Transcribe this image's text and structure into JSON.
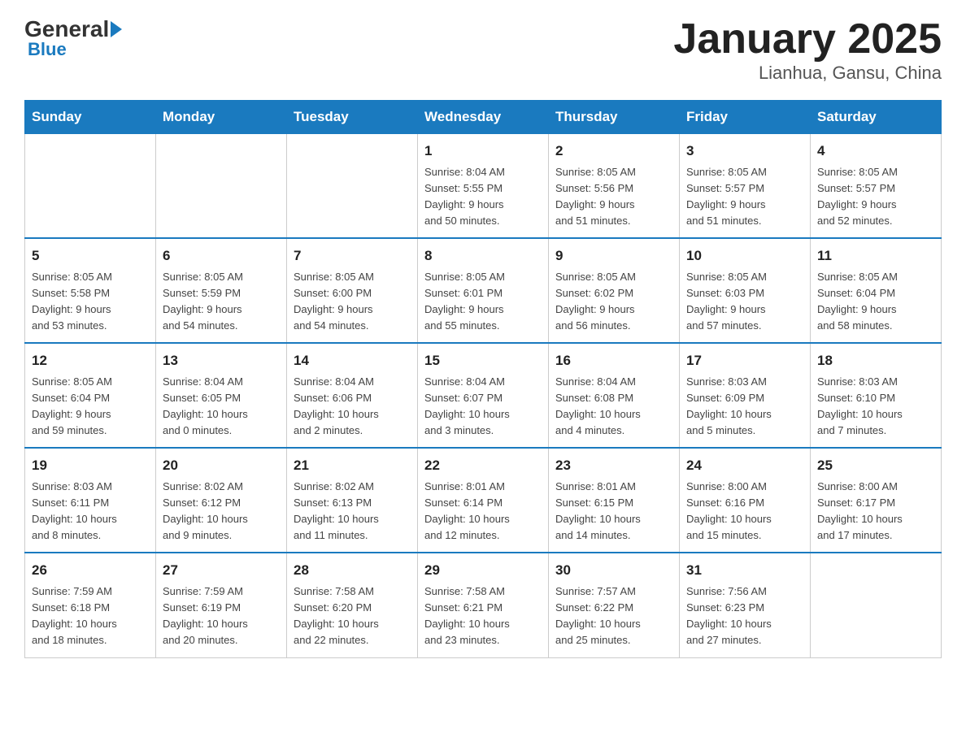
{
  "logo": {
    "general": "General",
    "blue": "Blue"
  },
  "title": "January 2025",
  "subtitle": "Lianhua, Gansu, China",
  "weekdays": [
    "Sunday",
    "Monday",
    "Tuesday",
    "Wednesday",
    "Thursday",
    "Friday",
    "Saturday"
  ],
  "weeks": [
    [
      {
        "day": "",
        "info": ""
      },
      {
        "day": "",
        "info": ""
      },
      {
        "day": "",
        "info": ""
      },
      {
        "day": "1",
        "info": "Sunrise: 8:04 AM\nSunset: 5:55 PM\nDaylight: 9 hours\nand 50 minutes."
      },
      {
        "day": "2",
        "info": "Sunrise: 8:05 AM\nSunset: 5:56 PM\nDaylight: 9 hours\nand 51 minutes."
      },
      {
        "day": "3",
        "info": "Sunrise: 8:05 AM\nSunset: 5:57 PM\nDaylight: 9 hours\nand 51 minutes."
      },
      {
        "day": "4",
        "info": "Sunrise: 8:05 AM\nSunset: 5:57 PM\nDaylight: 9 hours\nand 52 minutes."
      }
    ],
    [
      {
        "day": "5",
        "info": "Sunrise: 8:05 AM\nSunset: 5:58 PM\nDaylight: 9 hours\nand 53 minutes."
      },
      {
        "day": "6",
        "info": "Sunrise: 8:05 AM\nSunset: 5:59 PM\nDaylight: 9 hours\nand 54 minutes."
      },
      {
        "day": "7",
        "info": "Sunrise: 8:05 AM\nSunset: 6:00 PM\nDaylight: 9 hours\nand 54 minutes."
      },
      {
        "day": "8",
        "info": "Sunrise: 8:05 AM\nSunset: 6:01 PM\nDaylight: 9 hours\nand 55 minutes."
      },
      {
        "day": "9",
        "info": "Sunrise: 8:05 AM\nSunset: 6:02 PM\nDaylight: 9 hours\nand 56 minutes."
      },
      {
        "day": "10",
        "info": "Sunrise: 8:05 AM\nSunset: 6:03 PM\nDaylight: 9 hours\nand 57 minutes."
      },
      {
        "day": "11",
        "info": "Sunrise: 8:05 AM\nSunset: 6:04 PM\nDaylight: 9 hours\nand 58 minutes."
      }
    ],
    [
      {
        "day": "12",
        "info": "Sunrise: 8:05 AM\nSunset: 6:04 PM\nDaylight: 9 hours\nand 59 minutes."
      },
      {
        "day": "13",
        "info": "Sunrise: 8:04 AM\nSunset: 6:05 PM\nDaylight: 10 hours\nand 0 minutes."
      },
      {
        "day": "14",
        "info": "Sunrise: 8:04 AM\nSunset: 6:06 PM\nDaylight: 10 hours\nand 2 minutes."
      },
      {
        "day": "15",
        "info": "Sunrise: 8:04 AM\nSunset: 6:07 PM\nDaylight: 10 hours\nand 3 minutes."
      },
      {
        "day": "16",
        "info": "Sunrise: 8:04 AM\nSunset: 6:08 PM\nDaylight: 10 hours\nand 4 minutes."
      },
      {
        "day": "17",
        "info": "Sunrise: 8:03 AM\nSunset: 6:09 PM\nDaylight: 10 hours\nand 5 minutes."
      },
      {
        "day": "18",
        "info": "Sunrise: 8:03 AM\nSunset: 6:10 PM\nDaylight: 10 hours\nand 7 minutes."
      }
    ],
    [
      {
        "day": "19",
        "info": "Sunrise: 8:03 AM\nSunset: 6:11 PM\nDaylight: 10 hours\nand 8 minutes."
      },
      {
        "day": "20",
        "info": "Sunrise: 8:02 AM\nSunset: 6:12 PM\nDaylight: 10 hours\nand 9 minutes."
      },
      {
        "day": "21",
        "info": "Sunrise: 8:02 AM\nSunset: 6:13 PM\nDaylight: 10 hours\nand 11 minutes."
      },
      {
        "day": "22",
        "info": "Sunrise: 8:01 AM\nSunset: 6:14 PM\nDaylight: 10 hours\nand 12 minutes."
      },
      {
        "day": "23",
        "info": "Sunrise: 8:01 AM\nSunset: 6:15 PM\nDaylight: 10 hours\nand 14 minutes."
      },
      {
        "day": "24",
        "info": "Sunrise: 8:00 AM\nSunset: 6:16 PM\nDaylight: 10 hours\nand 15 minutes."
      },
      {
        "day": "25",
        "info": "Sunrise: 8:00 AM\nSunset: 6:17 PM\nDaylight: 10 hours\nand 17 minutes."
      }
    ],
    [
      {
        "day": "26",
        "info": "Sunrise: 7:59 AM\nSunset: 6:18 PM\nDaylight: 10 hours\nand 18 minutes."
      },
      {
        "day": "27",
        "info": "Sunrise: 7:59 AM\nSunset: 6:19 PM\nDaylight: 10 hours\nand 20 minutes."
      },
      {
        "day": "28",
        "info": "Sunrise: 7:58 AM\nSunset: 6:20 PM\nDaylight: 10 hours\nand 22 minutes."
      },
      {
        "day": "29",
        "info": "Sunrise: 7:58 AM\nSunset: 6:21 PM\nDaylight: 10 hours\nand 23 minutes."
      },
      {
        "day": "30",
        "info": "Sunrise: 7:57 AM\nSunset: 6:22 PM\nDaylight: 10 hours\nand 25 minutes."
      },
      {
        "day": "31",
        "info": "Sunrise: 7:56 AM\nSunset: 6:23 PM\nDaylight: 10 hours\nand 27 minutes."
      },
      {
        "day": "",
        "info": ""
      }
    ]
  ]
}
